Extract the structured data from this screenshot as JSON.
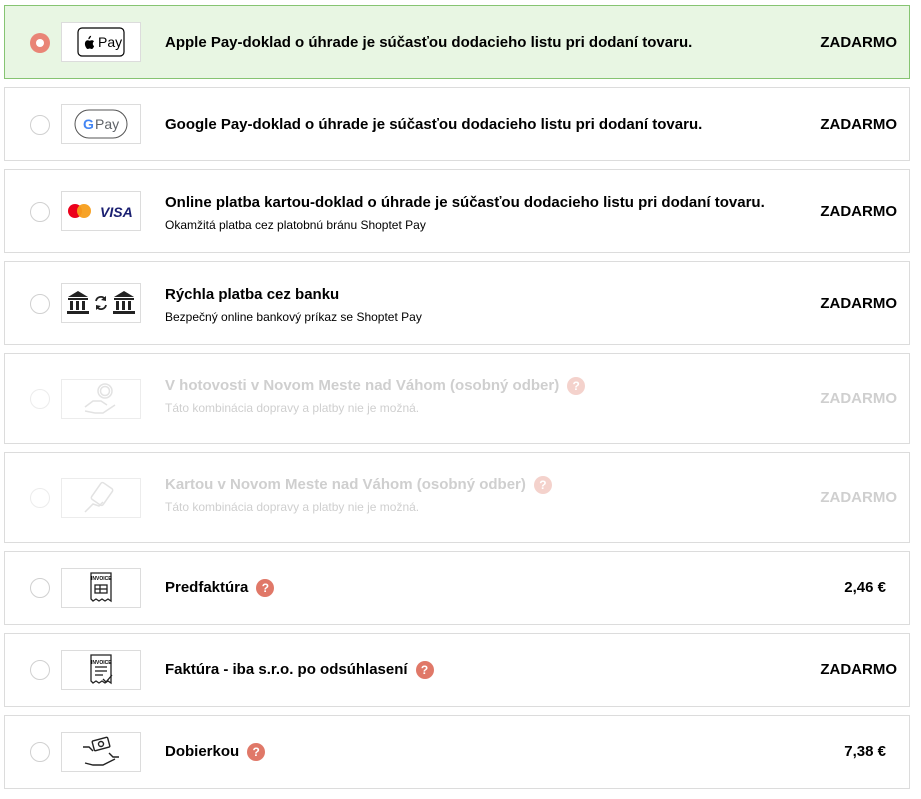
{
  "payment_options": [
    {
      "title": "Apple Pay-doklad o úhrade je súčasťou dodacieho listu pri dodaní tovaru.",
      "subtitle": "",
      "price": "ZADARMO",
      "logo": "apple-pay-icon",
      "logo_text": "Pay",
      "selected": true,
      "disabled": false,
      "help": false
    },
    {
      "title": "Google Pay-doklad o úhrade je súčasťou dodacieho listu pri dodaní tovaru.",
      "subtitle": "",
      "price": "ZADARMO",
      "logo": "google-pay-icon",
      "logo_text": "Pay",
      "logo_letter": "G",
      "selected": false,
      "disabled": false,
      "help": false
    },
    {
      "title": "Online platba kartou-doklad o úhrade je súčasťou dodacieho listu pri dodaní tovaru.",
      "subtitle": "Okamžitá platba cez platobnú bránu Shoptet Pay",
      "price": "ZADARMO",
      "logo": "mastercard-visa-icon",
      "logo_text": "VISA",
      "selected": false,
      "disabled": false,
      "help": false
    },
    {
      "title": "Rýchla platba cez banku",
      "subtitle": "Bezpečný online bankový príkaz se Shoptet Pay",
      "price": "ZADARMO",
      "logo": "bank-transfer-icon",
      "selected": false,
      "disabled": false,
      "help": false
    },
    {
      "title": "V hotovosti v Novom Meste nad Váhom (osobný odber)",
      "subtitle": "Táto kombinácia dopravy a platby nie je možná.",
      "price": "ZADARMO",
      "logo": "cash-hand-icon",
      "selected": false,
      "disabled": true,
      "help": true
    },
    {
      "title": "Kartou v Novom Meste nad Váhom (osobný odber)",
      "subtitle": "Táto kombinácia dopravy a platby nie je možná.",
      "price": "ZADARMO",
      "logo": "card-hand-icon",
      "selected": false,
      "disabled": true,
      "help": true
    },
    {
      "title": "Predfaktúra",
      "subtitle": "",
      "price": "2,46 €",
      "logo": "invoice-icon",
      "logo_text": "INVOICE",
      "selected": false,
      "disabled": false,
      "help": true
    },
    {
      "title": "Faktúra - iba s.r.o. po odsúhlasení",
      "subtitle": "",
      "price": "ZADARMO",
      "logo": "invoice-approved-icon",
      "logo_text": "INVOICE",
      "selected": false,
      "disabled": false,
      "help": true
    },
    {
      "title": "Dobierkou",
      "subtitle": "",
      "price": "7,38 €",
      "logo": "cash-on-delivery-icon",
      "selected": false,
      "disabled": false,
      "help": true
    }
  ],
  "help_symbol": "?",
  "colors": {
    "selected_bg": "#e8f6e3",
    "selected_border": "#86c472",
    "radio_selected": "#e98577",
    "help_badge": "#e07868",
    "border": "#dcdcdc"
  }
}
